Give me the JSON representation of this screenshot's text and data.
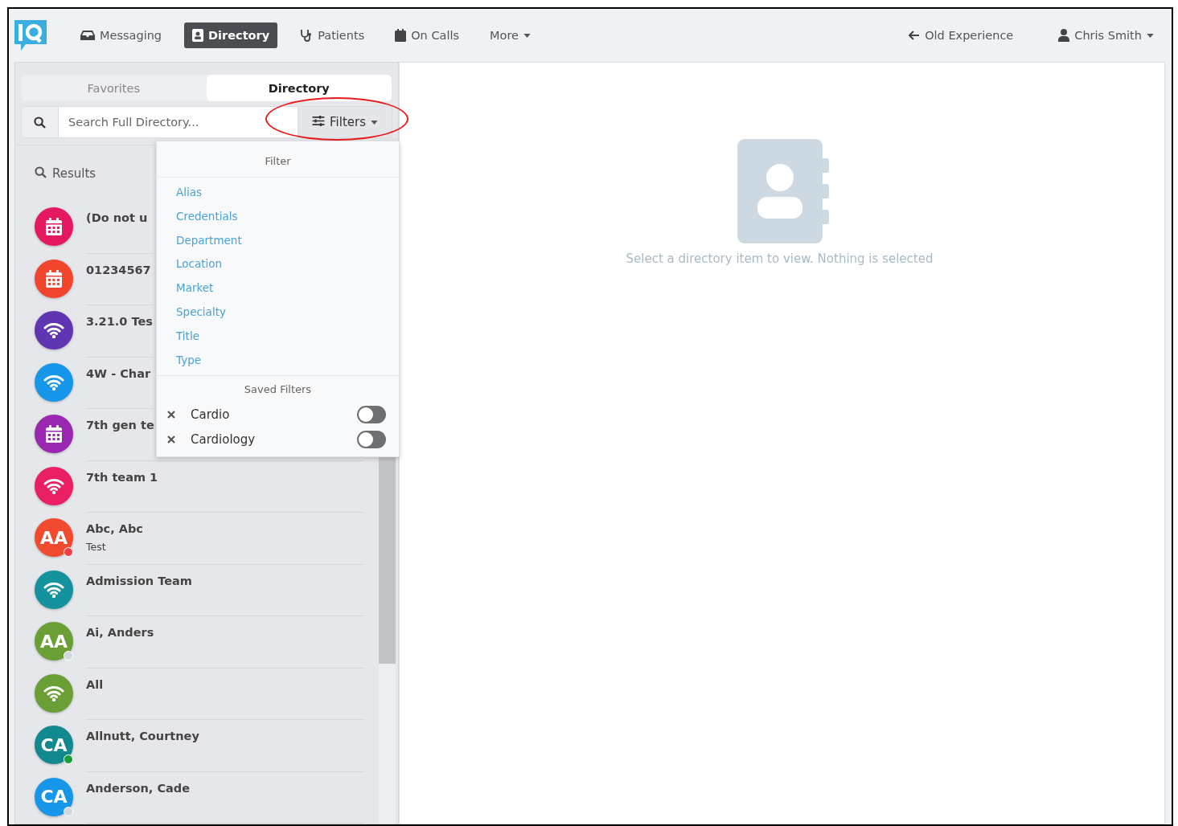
{
  "nav": {
    "items": [
      {
        "label": "Messaging",
        "kind": "inbox",
        "selected": false
      },
      {
        "label": "Directory",
        "kind": "book",
        "selected": true
      },
      {
        "label": "Patients",
        "kind": "stethoscope",
        "selected": false
      },
      {
        "label": "On Calls",
        "kind": "calendar",
        "selected": false
      },
      {
        "label": "More",
        "kind": "dropdown",
        "selected": false
      }
    ],
    "right": [
      {
        "label": "Old Experience",
        "kind": "back"
      },
      {
        "label": "Chris Smith",
        "kind": "user"
      }
    ]
  },
  "tabs": [
    {
      "label": "Favorites",
      "selected": false
    },
    {
      "label": "Directory",
      "selected": true
    }
  ],
  "search": {
    "placeholder": "Search Full Directory..."
  },
  "filters_button": {
    "label": "Filters",
    "highlighted": true
  },
  "filter_menu": {
    "header": "Filter",
    "items": [
      "Alias",
      "Credentials",
      "Department",
      "Location",
      "Market",
      "Specialty",
      "Title",
      "Type"
    ],
    "saved_header": "Saved Filters",
    "saved": [
      {
        "name": "Cardio",
        "on": false
      },
      {
        "name": "Cardiology",
        "on": false
      }
    ]
  },
  "results_label": "Results",
  "results": [
    {
      "name": "(Do not u",
      "kind": "calendar",
      "color": "#e5195f"
    },
    {
      "name": "01234567",
      "kind": "calendar",
      "color": "#f1452d"
    },
    {
      "name": "3.21.0 Tes",
      "kind": "wifi",
      "color": "#6035b1"
    },
    {
      "name": "4W - Char",
      "kind": "wifi",
      "color": "#1596e8"
    },
    {
      "name": "7th gen te",
      "kind": "calendar",
      "color": "#9a27b0"
    },
    {
      "name": "7th team 1",
      "kind": "wifi",
      "color": "#e91e63"
    },
    {
      "name": "Abc, Abc",
      "subtitle": "Test",
      "kind": "initials",
      "initials": "AA",
      "color": "#f24a2e",
      "status_dot": {
        "color": "#f2404b"
      }
    },
    {
      "name": "Admission Team",
      "kind": "wifi",
      "color": "#14939f"
    },
    {
      "name": "Ai, Anders",
      "kind": "initials",
      "initials": "AA",
      "color": "#6a9f36",
      "status_dot": {
        "color": "#d3d6dc"
      }
    },
    {
      "name": "All",
      "kind": "wifi",
      "color": "#6a9f36"
    },
    {
      "name": "Allnutt, Courtney",
      "kind": "initials",
      "initials": "CA",
      "color": "#12888f",
      "status_dot": {
        "color": "#1a9b3c"
      }
    },
    {
      "name": "Anderson, Cade",
      "kind": "initials",
      "initials": "CA",
      "color": "#1596e8",
      "status_dot": {
        "color": "#d3d6dc"
      }
    }
  ],
  "empty_state": {
    "message": "Select a directory item to view. Nothing is selected"
  }
}
